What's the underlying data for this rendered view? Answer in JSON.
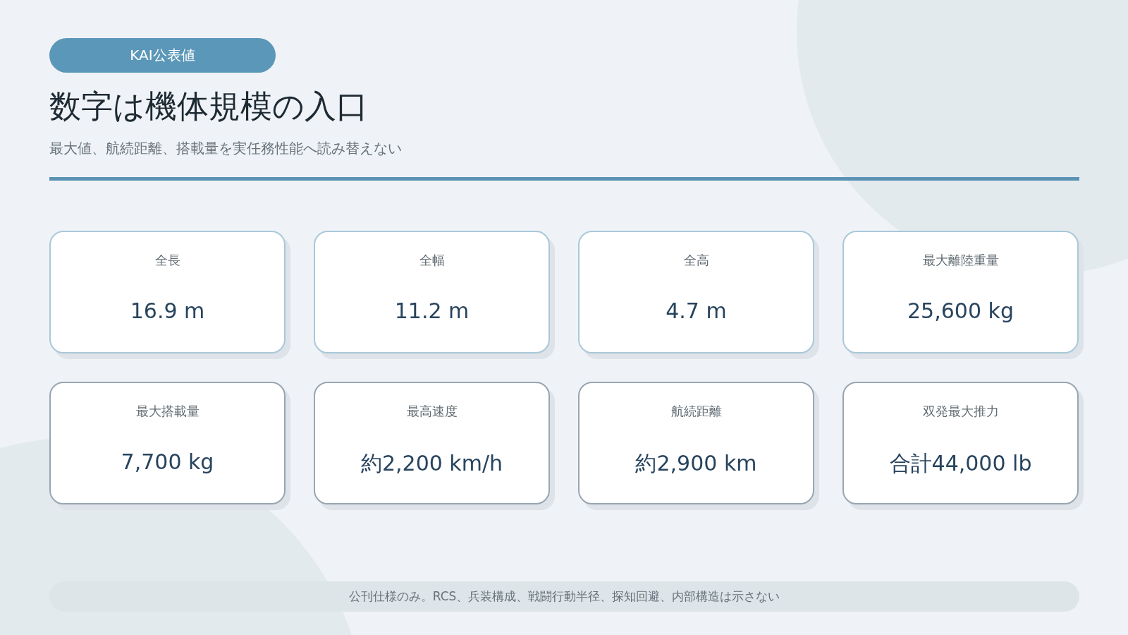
{
  "badge": "KAI公表値",
  "title": "数字は機体規模の入口",
  "subtitle": "最大値、航続距離、搭載量を実任務性能へ読み替えない",
  "rows": [
    {
      "kind": "dimension",
      "cards": [
        {
          "label": "全長",
          "value": "16.9 m"
        },
        {
          "label": "全幅",
          "value": "11.2 m"
        },
        {
          "label": "全高",
          "value": "4.7 m"
        },
        {
          "label": "最大離陸重量",
          "value": "25,600 kg"
        }
      ]
    },
    {
      "kind": "performance",
      "cards": [
        {
          "label": "最大搭載量",
          "value": "7,700 kg"
        },
        {
          "label": "最高速度",
          "value": "約2,200 km/h"
        },
        {
          "label": "航続距離",
          "value": "約2,900 km"
        },
        {
          "label": "双発最大推力",
          "value": "合計44,000 lb"
        }
      ]
    }
  ],
  "footer": "公刊仕様のみ。RCS、兵装構成、戦闘行動半径、探知回避、内部構造は示さない"
}
